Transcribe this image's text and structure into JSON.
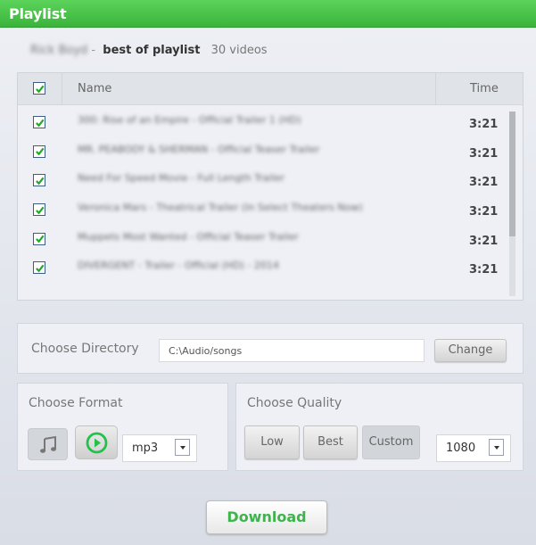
{
  "window": {
    "title": "Playlist"
  },
  "playlist": {
    "owner": "Rick Boyd",
    "separator": "-",
    "name": "best of playlist",
    "count": "30 videos"
  },
  "table": {
    "headers": {
      "name": "Name",
      "time": "Time"
    },
    "select_all_checked": true,
    "rows": [
      {
        "checked": true,
        "title": "300: Rise of an Empire - Official Trailer 1 (HD)",
        "time": "3:21"
      },
      {
        "checked": true,
        "title": "MR. PEABODY & SHERMAN - Official Teaser Trailer",
        "time": "3:21"
      },
      {
        "checked": true,
        "title": "Need For Speed Movie - Full Length Trailer",
        "time": "3:21"
      },
      {
        "checked": true,
        "title": "Veronica Mars - Theatrical Trailer (In Select Theaters Now)",
        "time": "3:21"
      },
      {
        "checked": true,
        "title": "Muppets Most Wanted - Official Teaser Trailer",
        "time": "3:21"
      },
      {
        "checked": true,
        "title": "DIVERGENT - Trailer - Official (HD) - 2014",
        "time": "3:21"
      }
    ],
    "scroll_position": 0
  },
  "directory": {
    "label": "Choose Directory",
    "value": "C:\\Audio/songs",
    "change_label": "Change"
  },
  "format": {
    "label": "Choose Format",
    "audio_icon": "music-note-icon",
    "video_icon": "play-circle-icon",
    "selected": "mp3"
  },
  "quality": {
    "label": "Choose Quality",
    "options": [
      "Low",
      "Best",
      "Custom"
    ],
    "active": "Custom",
    "resolution": "1080"
  },
  "download_label": "Download",
  "colors": {
    "accent": "#3cb64a",
    "title_bar": "#4cc64b",
    "check": "#2aa52c"
  }
}
